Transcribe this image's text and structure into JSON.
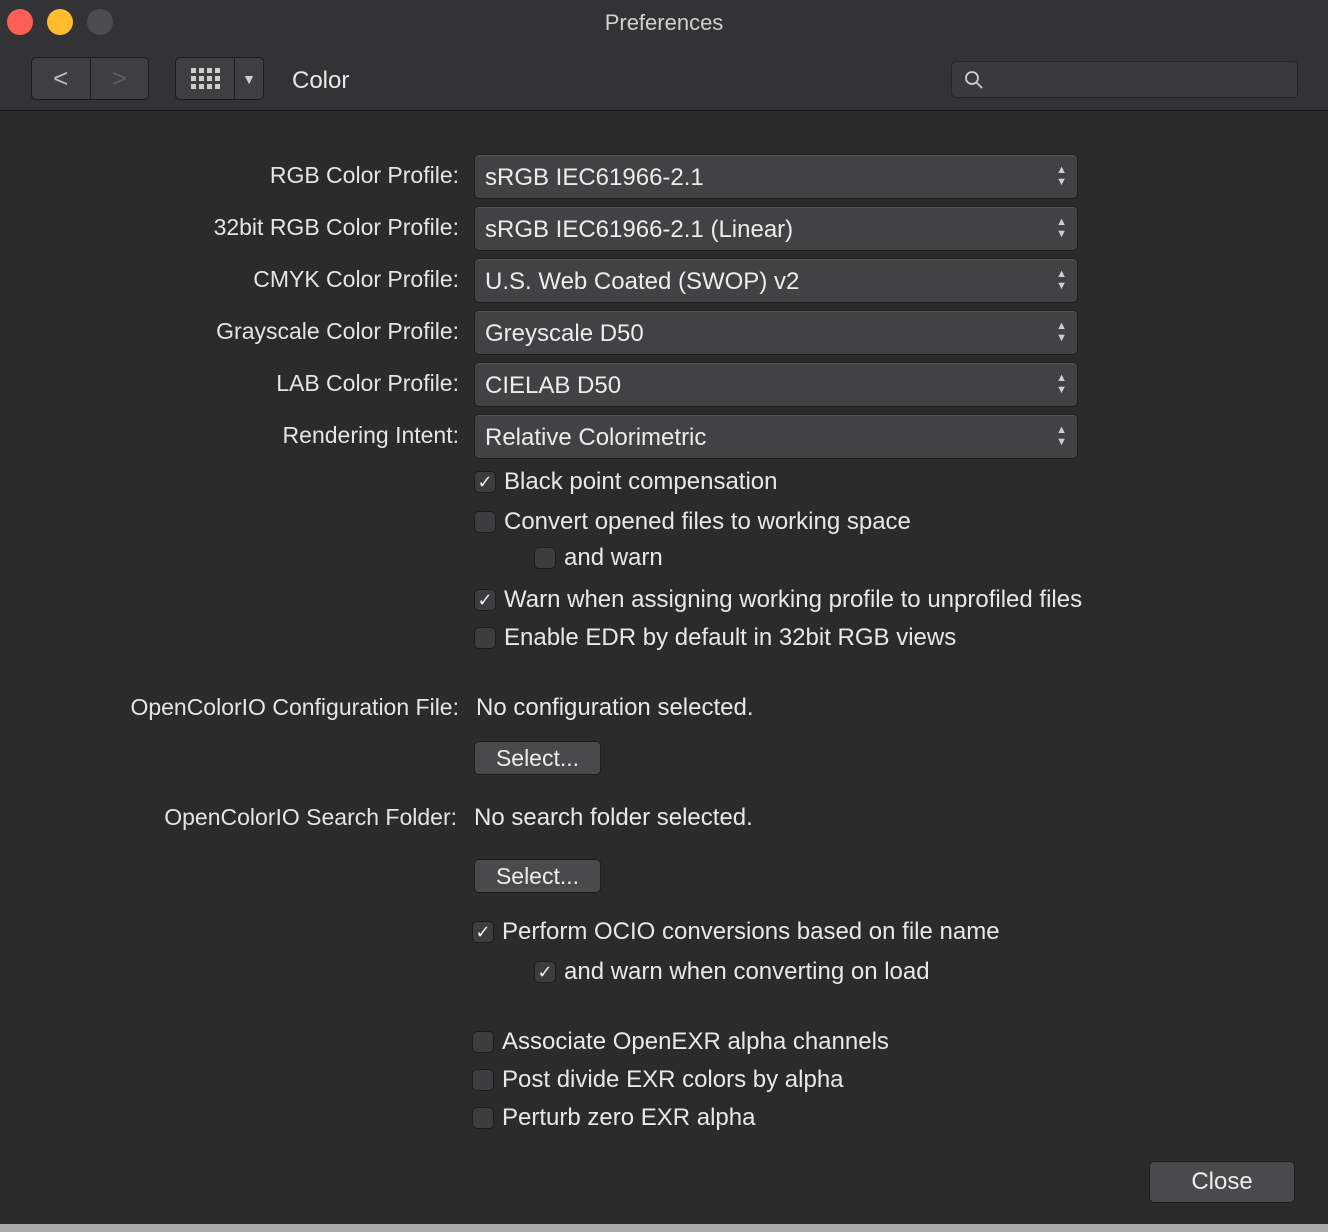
{
  "window": {
    "title": "Preferences"
  },
  "toolbar": {
    "back_glyph": "<",
    "forward_glyph": ">",
    "section": "Color",
    "search_placeholder": ""
  },
  "profiles": [
    {
      "label": "RGB Color Profile:",
      "value": "sRGB IEC61966-2.1"
    },
    {
      "label": "32bit RGB Color Profile:",
      "value": "sRGB IEC61966-2.1 (Linear)"
    },
    {
      "label": "CMYK Color Profile:",
      "value": "U.S. Web Coated (SWOP) v2"
    },
    {
      "label": "Grayscale Color Profile:",
      "value": "Greyscale D50"
    },
    {
      "label": "LAB Color Profile:",
      "value": "CIELAB D50"
    },
    {
      "label": "Rendering Intent:",
      "value": "Relative Colorimetric"
    }
  ],
  "checks": {
    "black_point": {
      "label": "Black point compensation",
      "checked": true
    },
    "convert_opened": {
      "label": "Convert opened files to working space",
      "checked": false
    },
    "and_warn": {
      "label": "and warn",
      "checked": false
    },
    "warn_assigning": {
      "label": "Warn when assigning working profile to unprofiled files",
      "checked": true
    },
    "enable_edr": {
      "label": "Enable EDR by default in 32bit RGB views",
      "checked": false
    },
    "perform_ocio": {
      "label": "Perform OCIO conversions based on file name",
      "checked": true
    },
    "warn_converting": {
      "label": "and warn when converting on load",
      "checked": true
    },
    "associate_exr": {
      "label": "Associate OpenEXR alpha channels",
      "checked": false
    },
    "post_divide": {
      "label": "Post divide EXR colors by alpha",
      "checked": false
    },
    "perturb_zero": {
      "label": "Perturb zero EXR alpha",
      "checked": false
    }
  },
  "ocio": {
    "config_label": "OpenColorIO Configuration File:",
    "config_value": "No configuration selected.",
    "config_button": "Select...",
    "folder_label": "OpenColorIO Search Folder:",
    "folder_value": "No search folder selected.",
    "folder_button": "Select..."
  },
  "footer": {
    "close_label": "Close"
  },
  "colors": {
    "background": "#2b2b2b",
    "titlebar": "#333335",
    "close_light": "#ff5f57",
    "minimize_light": "#febc2e",
    "zoom_light": "#4d4d4f"
  }
}
